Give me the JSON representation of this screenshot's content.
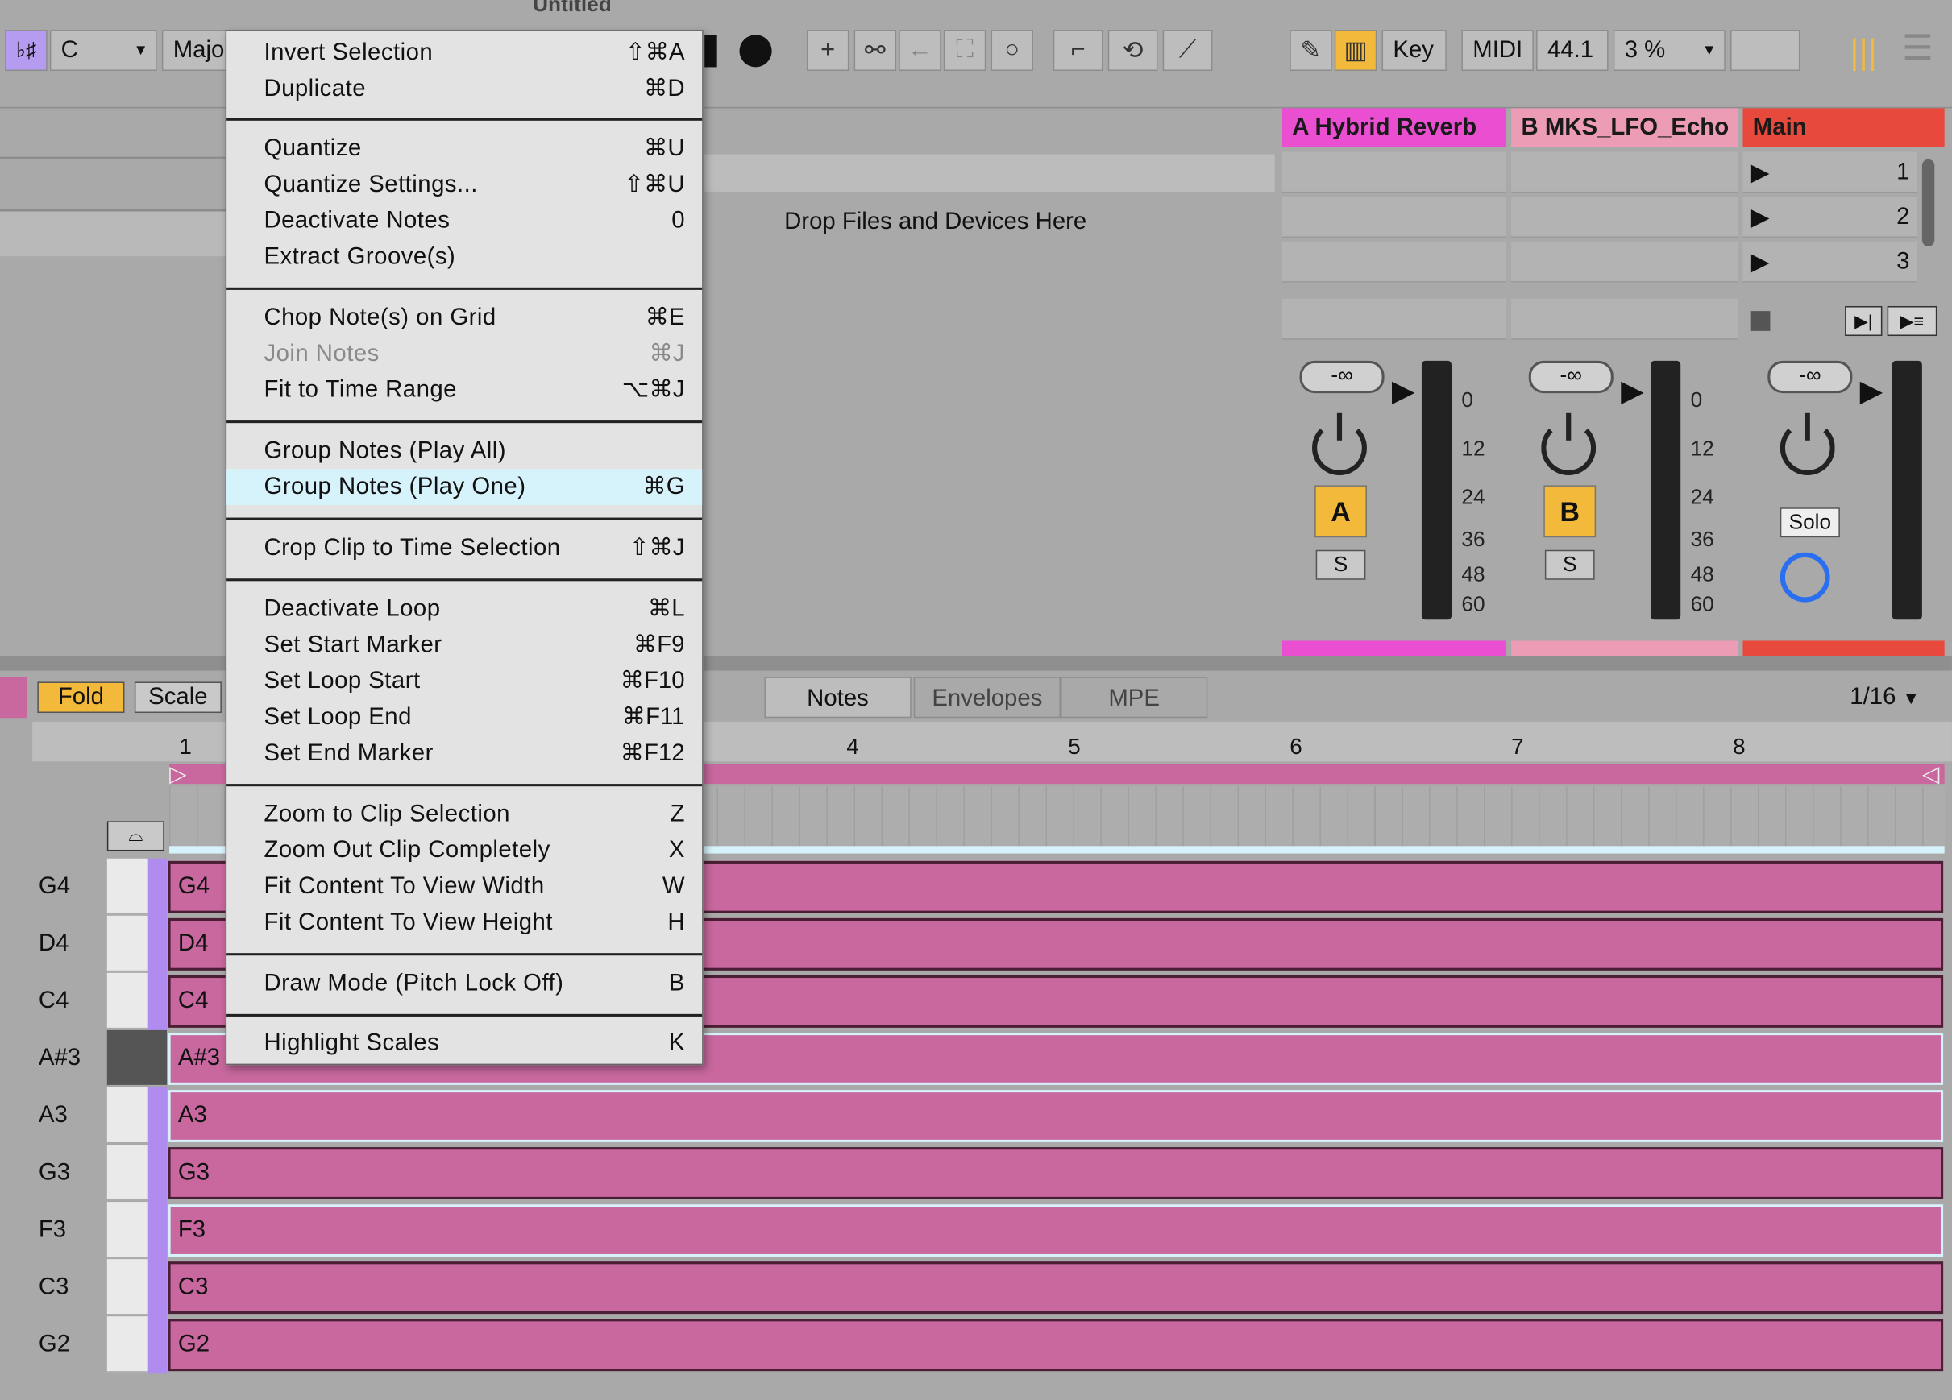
{
  "window_title": "Untitled",
  "toolbar": {
    "key_icon_label": "♭♯",
    "root_note": "C",
    "scale_name": "Majo",
    "key_button": "Key",
    "midi_button": "MIDI",
    "sample_rate": "44.1",
    "cpu_load": "3 %"
  },
  "session": {
    "drop_hint": "Drop Files and Devices Here",
    "tracks": [
      {
        "title": "A Hybrid Reverb",
        "color": "#e94fd0",
        "volume": "-∞",
        "activator": "A",
        "solo": "S"
      },
      {
        "title": "B MKS_LFO_Echo",
        "color": "#ec9db5",
        "volume": "-∞",
        "activator": "B",
        "solo": "S"
      },
      {
        "title": "Main",
        "color": "#e8493d",
        "volume": "-∞",
        "solo": "Solo"
      }
    ],
    "scenes": [
      "1",
      "2",
      "3"
    ],
    "meter_scale": [
      "0",
      "12",
      "24",
      "36",
      "48",
      "60"
    ]
  },
  "editor": {
    "fold": "Fold",
    "scale": "Scale",
    "tabs": [
      "Notes",
      "Envelopes",
      "MPE"
    ],
    "grid": "1/16",
    "bars": [
      "1",
      "4",
      "5",
      "6",
      "7",
      "8"
    ],
    "rows": [
      "G4",
      "D4",
      "C4",
      "A#3",
      "A3",
      "G3",
      "F3",
      "C3",
      "G2"
    ]
  },
  "menu": {
    "groups": [
      [
        {
          "label": "Invert Selection",
          "shortcut": "⇧⌘A"
        },
        {
          "label": "Duplicate",
          "shortcut": "⌘D"
        }
      ],
      [
        {
          "label": "Quantize",
          "shortcut": "⌘U"
        },
        {
          "label": "Quantize Settings...",
          "shortcut": "⇧⌘U"
        },
        {
          "label": "Deactivate Notes",
          "shortcut": "0"
        },
        {
          "label": "Extract Groove(s)",
          "shortcut": ""
        }
      ],
      [
        {
          "label": "Chop Note(s) on Grid",
          "shortcut": "⌘E"
        },
        {
          "label": "Join Notes",
          "shortcut": "⌘J",
          "disabled": true
        },
        {
          "label": "Fit to Time Range",
          "shortcut": "⌥⌘J"
        }
      ],
      [
        {
          "label": "Group Notes (Play All)",
          "shortcut": ""
        },
        {
          "label": "Group Notes (Play One)",
          "shortcut": "⌘G",
          "highlighted": true
        }
      ],
      [
        {
          "label": "Crop Clip to Time Selection",
          "shortcut": "⇧⌘J"
        }
      ],
      [
        {
          "label": "Deactivate Loop",
          "shortcut": "⌘L"
        },
        {
          "label": "Set Start Marker",
          "shortcut": "⌘F9"
        },
        {
          "label": "Set Loop Start",
          "shortcut": "⌘F10"
        },
        {
          "label": "Set Loop End",
          "shortcut": "⌘F11"
        },
        {
          "label": "Set End Marker",
          "shortcut": "⌘F12"
        }
      ],
      [
        {
          "label": "Zoom to Clip Selection",
          "shortcut": "Z"
        },
        {
          "label": "Zoom Out Clip Completely",
          "shortcut": "X"
        },
        {
          "label": "Fit Content To View Width",
          "shortcut": "W"
        },
        {
          "label": "Fit Content To View Height",
          "shortcut": "H"
        }
      ],
      [
        {
          "label": "Draw Mode (Pitch Lock Off)",
          "shortcut": "B"
        }
      ],
      [
        {
          "label": "Highlight Scales",
          "shortcut": "K"
        }
      ]
    ]
  }
}
